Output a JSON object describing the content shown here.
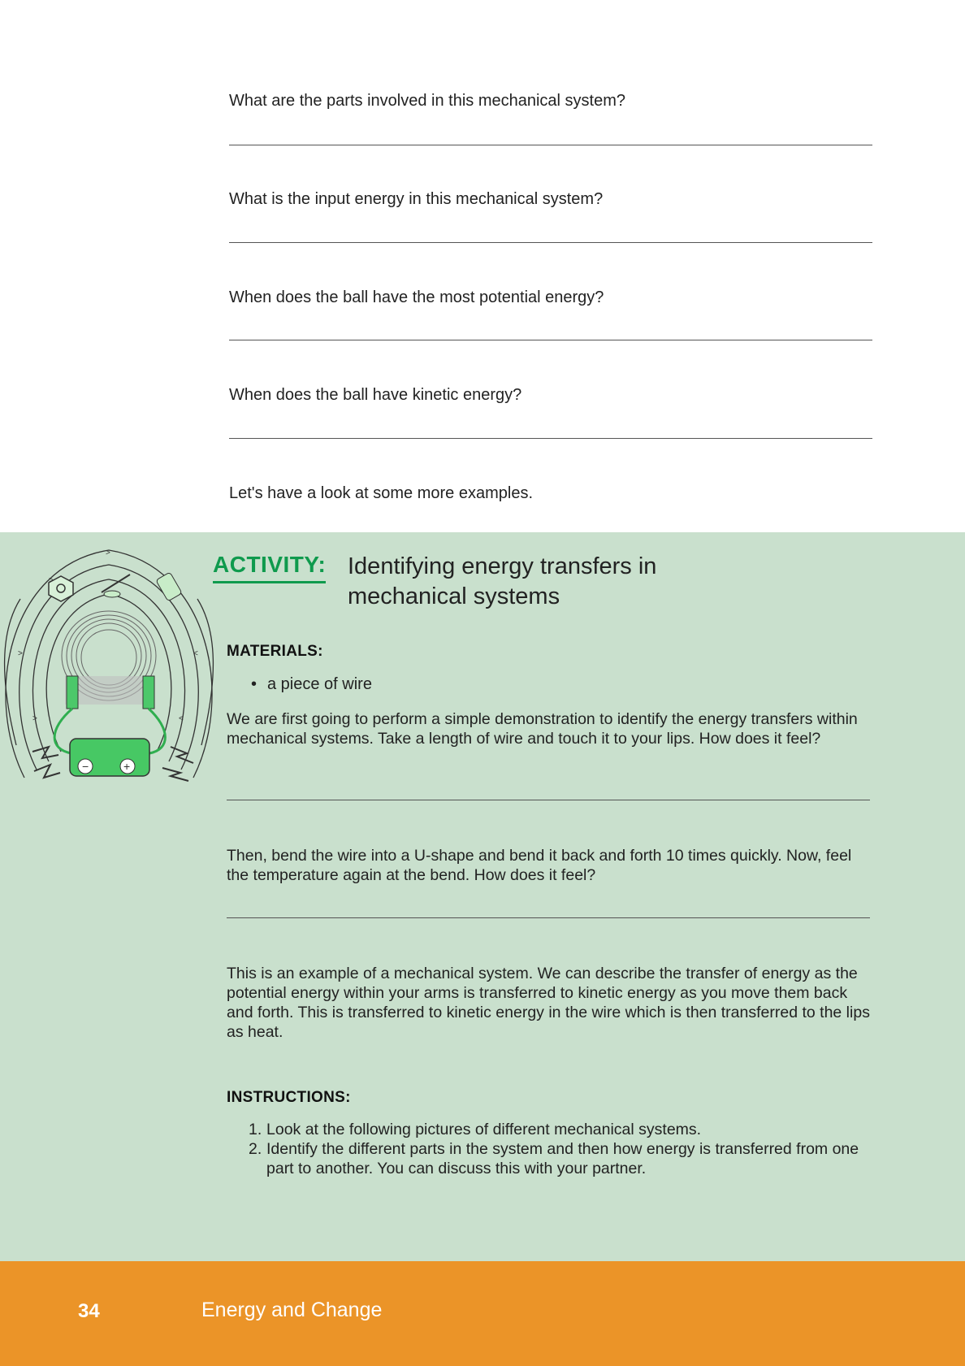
{
  "questions": [
    "What are the parts involved in this mechanical system?",
    "What is the input energy in this mechanical system?",
    "When does the ball have the most potential energy?",
    "When does the ball have kinetic energy?"
  ],
  "intro": "Let's have a look at some more examples.",
  "activity": {
    "label": "ACTIVITY:",
    "title": "Identifying energy transfers in mechanical systems",
    "materials_heading": "MATERIALS:",
    "materials": [
      "a piece of wire"
    ],
    "paragraph1": "We are first going to perform a simple demonstration to identify the energy transfers within mechanical systems. Take a length of wire and touch it to your lips. How does it feel?",
    "paragraph2": "Then, bend the wire into a U-shape and bend it back and forth 10 times quickly. Now, feel the temperature again at the bend. How does it feel?",
    "paragraph3": "This is an example of a mechanical system. We can describe the transfer of energy as the potential energy within your arms is transferred to kinetic energy as you move them back and forth. This is transferred to kinetic energy in the wire which is then transferred to the lips as heat.",
    "instructions_heading": "INSTRUCTIONS:",
    "instructions": [
      "Look at the following pictures of different mechanical systems.",
      "Identify the different parts in the system and then how energy is transferred from one part to another. You can discuss this with your partner."
    ]
  },
  "footer": {
    "page_number": "34",
    "title": "Energy and Change"
  },
  "colors": {
    "activity_bg": "#c9e0cd",
    "activity_label": "#0f9a4d",
    "footer_bg": "#eb9428"
  }
}
